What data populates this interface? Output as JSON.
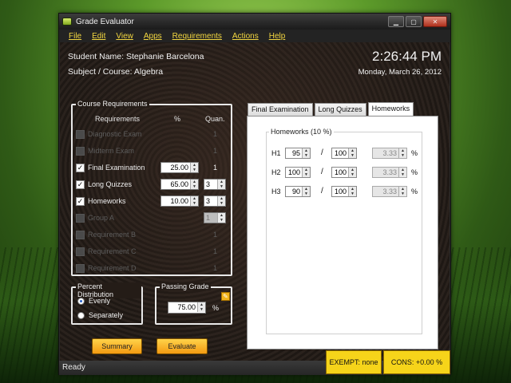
{
  "window": {
    "title": "Grade Evaluator",
    "min": "▁",
    "max": "▢",
    "close": "✕"
  },
  "menu": [
    "File",
    "Edit",
    "View",
    "Apps",
    "Requirements",
    "Actions",
    "Help"
  ],
  "header": {
    "student": "Student Name: Stephanie Barcelona",
    "subject": "Subject / Course: Algebra",
    "time": "2:26:44 PM",
    "date": "Monday, March 26, 2012"
  },
  "course_requirements": {
    "legend": "Course Requirements",
    "col_requirements": "Requirements",
    "col_percent": "%",
    "col_quan": "Quan.",
    "rows": [
      {
        "label": "Diagnostic Exam",
        "checked": false,
        "enabled": false,
        "percent": "",
        "quan": "1"
      },
      {
        "label": "Midterm Exam",
        "checked": false,
        "enabled": false,
        "percent": "",
        "quan": "1"
      },
      {
        "label": "Final Examination",
        "checked": true,
        "enabled": true,
        "percent": "25.00",
        "quan": "1"
      },
      {
        "label": "Long Quizzes",
        "checked": true,
        "enabled": true,
        "percent": "65.00",
        "quan": "3"
      },
      {
        "label": "Homeworks",
        "checked": true,
        "enabled": true,
        "percent": "10.00",
        "quan": "3"
      },
      {
        "label": "Group A",
        "checked": false,
        "enabled": false,
        "percent": "",
        "quan": "1"
      },
      {
        "label": "Requirement B",
        "checked": false,
        "enabled": false,
        "percent": "",
        "quan": "1"
      },
      {
        "label": "Requirement C",
        "checked": false,
        "enabled": false,
        "percent": "",
        "quan": "1"
      },
      {
        "label": "Requirement D",
        "checked": false,
        "enabled": false,
        "percent": "",
        "quan": "1"
      }
    ]
  },
  "percent_distribution": {
    "legend": "Percent Distribution",
    "options": [
      "Evenly",
      "Separately"
    ],
    "selected": "Evenly"
  },
  "passing_grade": {
    "legend": "Passing Grade",
    "value": "75.00",
    "unit": "%"
  },
  "buttons": {
    "summary": "Summary",
    "evaluate": "Evaluate"
  },
  "tabs": [
    "Final Examination",
    "Long Quizzes",
    "Homeworks"
  ],
  "active_tab": "Homeworks",
  "homeworks": {
    "legend": "Homeworks (10 %)",
    "rows": [
      {
        "label": "H1",
        "score": "95",
        "total": "100",
        "result": "3.33",
        "unit": "%"
      },
      {
        "label": "H2",
        "score": "100",
        "total": "100",
        "result": "3.33",
        "unit": "%"
      },
      {
        "label": "H3",
        "score": "90",
        "total": "100",
        "result": "3.33",
        "unit": "%"
      }
    ]
  },
  "status": {
    "text": "Ready",
    "exempt": "EXEMPT: none",
    "cons": "CONS: +0.00 %"
  },
  "colors": {
    "accent": "#f6d41a",
    "menu_text": "#f2d640",
    "button": "#f39a12"
  }
}
